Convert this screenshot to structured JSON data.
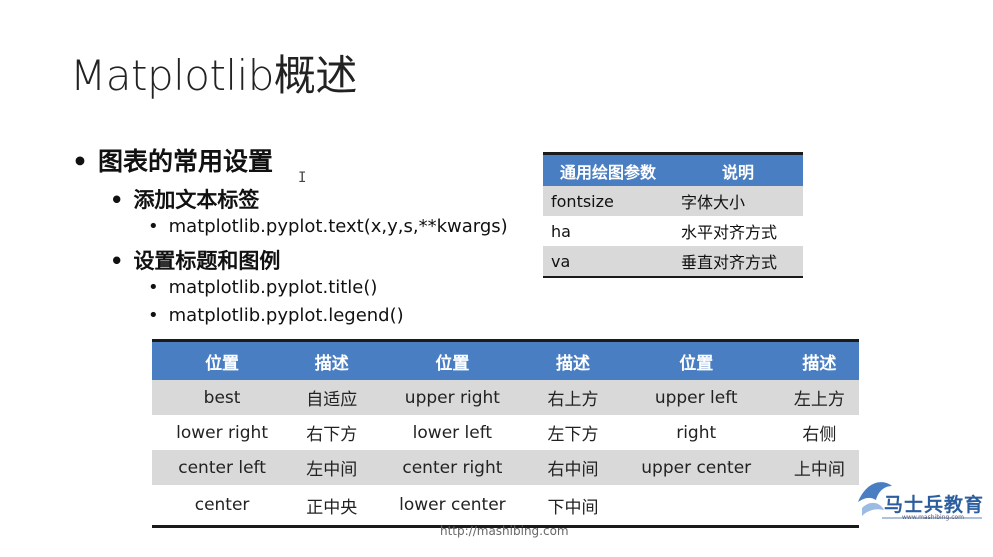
{
  "slide": {
    "title": "Matplotlib概述",
    "bullets": {
      "l1": "图表的常用设置",
      "l2a": "添加文本标签",
      "l3a": "matplotlib.pyplot.text(x,y,s,**kwargs)",
      "l2b": "设置标题和图例",
      "l3b": "matplotlib.pyplot.title()",
      "l3c": "matplotlib.pyplot.legend()",
      "dot": "•"
    },
    "cursor": "I"
  },
  "param_table": {
    "headers": [
      "通用绘图参数",
      "说明"
    ],
    "rows": [
      [
        "fontsize",
        "字体大小"
      ],
      [
        "ha",
        "水平对齐方式"
      ],
      [
        "va",
        "垂直对齐方式"
      ]
    ]
  },
  "loc_table": {
    "headers": [
      "位置",
      "描述",
      "位置",
      "描述",
      "位置",
      "描述"
    ],
    "rows": [
      [
        "best",
        "自适应",
        "upper right",
        "右上方",
        "upper left",
        "左上方"
      ],
      [
        "lower right",
        "右下方",
        "lower left",
        "左下方",
        "right",
        "右侧"
      ],
      [
        "center left",
        "左中间",
        "center right",
        "右中间",
        "upper center",
        "上中间"
      ],
      [
        "center",
        "正中央",
        "lower center",
        "下中间",
        "",
        ""
      ]
    ]
  },
  "footer": {
    "url": "http://mashibing.com",
    "logo_text": "马士兵教育",
    "logo_sub": "www.mashibing.com",
    "logo_color": "#2c5d9e"
  },
  "colors": {
    "header_blue": "#4a7ec3",
    "stripe_gray": "#d9d9d9"
  }
}
